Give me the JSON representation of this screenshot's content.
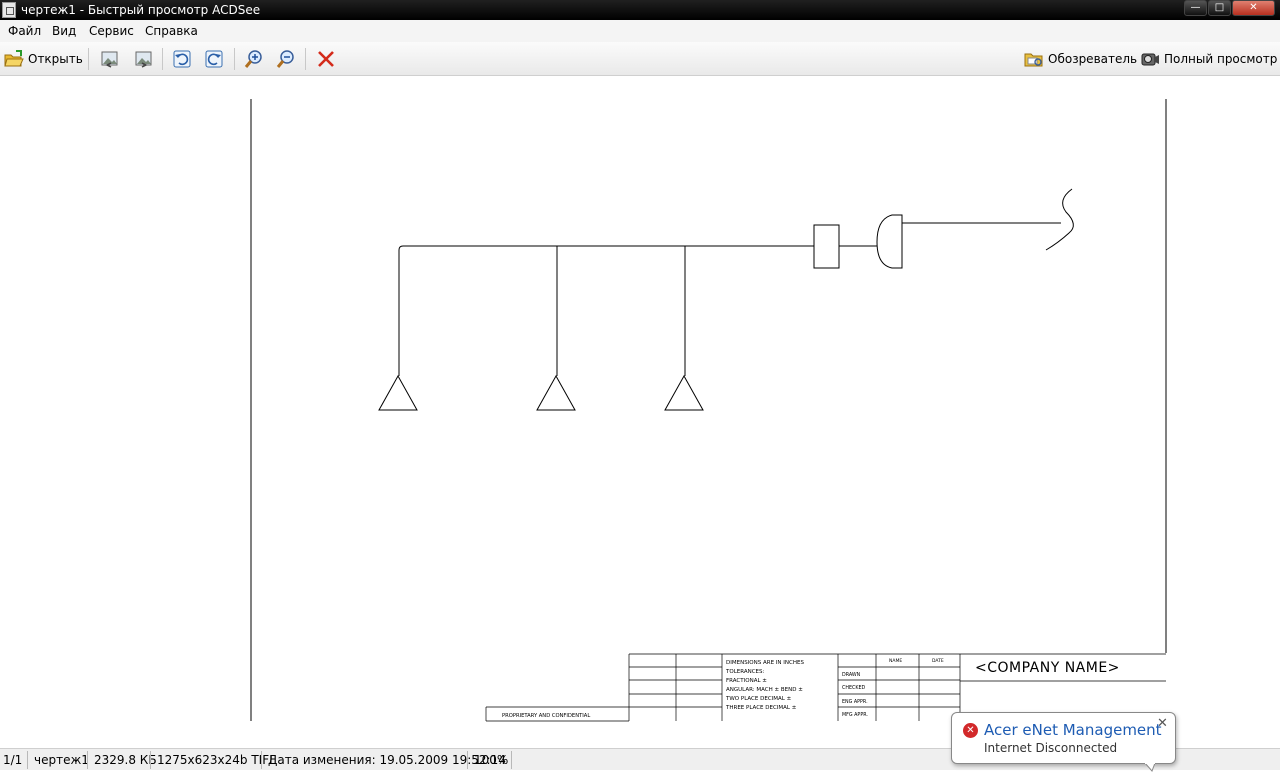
{
  "window": {
    "title": "чертеж1 - Быстрый просмотр ACDSee"
  },
  "menu": [
    "Файл",
    "Вид",
    "Сервис",
    "Справка"
  ],
  "toolbar": {
    "open_label": "Открыть",
    "browser_label": "Обозреватель",
    "fullview_label": "Полный просмотр"
  },
  "drawing": {
    "title_block": {
      "dimensions": "DIMENSIONS ARE IN INCHES",
      "tolerances": "TOLERANCES:",
      "fractional": "FRACTIONAL ±",
      "angular": "ANGULAR: MACH ±     BEND ±",
      "two_place": "TWO PLACE DECIMAL   ±",
      "three_place": "THREE PLACE DECIMAL  ±",
      "name_header": "NAME",
      "date_header": "DATE",
      "drawn": "DRAWN",
      "checked": "CHECKED",
      "eng_appr": "ENG APPR.",
      "mfg_appr": "MFG APPR.",
      "company": "<COMPANY NAME>",
      "proprietary": "PROPRIETARY AND CONFIDENTIAL"
    }
  },
  "status": {
    "page": "1/1",
    "filename": "чертеж1",
    "size": "2329.8 КБ",
    "dims": "1275x623x24b TIFF",
    "modified": "Дата изменения: 19.05.2009 19:52:14",
    "zoom": "100%"
  },
  "notification": {
    "title": "Acer eNet Management",
    "message": "Internet Disconnected"
  }
}
